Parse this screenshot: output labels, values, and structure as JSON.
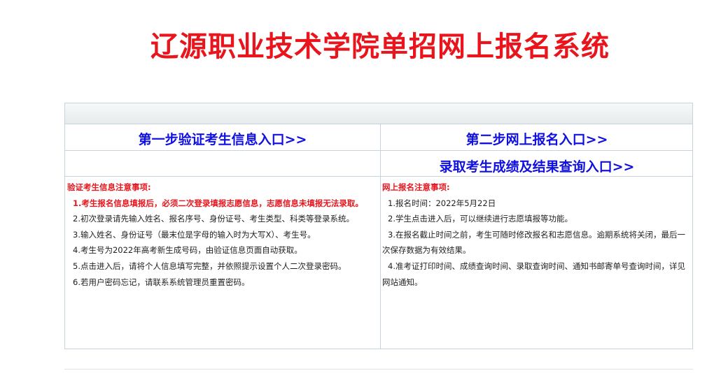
{
  "page_title": "辽源职业技术学院单招网上报名系统",
  "entries": {
    "step1": "第一步验证考生信息入口>>",
    "step2": "第二步网上报名入口>>",
    "results": "录取考生成绩及结果查询入口>>"
  },
  "verify_notes": {
    "heading": "验证考生信息注意事项:",
    "items": [
      "1.考生报名信息填报后，必须二次登录填报志愿信息，志愿信息未填报无法录取。",
      "2.初次登录请先输入姓名、报名序号、身份证号、考生类型、科类等登录系统。",
      "3.输入姓名、身份证号（最末位是字母的输入时为大写X）、考生号。",
      "4.考生号为2022年高考新生成号码，由验证信息页面自动获取。",
      "5.点击进入后，请将个人信息填写完整，并依照提示设置个人二次登录密码。",
      "6.若用户密码忘记，请联系系统管理员重置密码。"
    ]
  },
  "reg_notes": {
    "heading": "网上报名注意事项:",
    "items": [
      "1.报名时间：2022年5月22日",
      "2.学生点击进入后，可以继续进行志愿填报等功能。",
      "3.在报名截止时间之前，考生可随时修改报名和志愿信息。逾期系统将关闭，最后一次保存数据为有效结果。",
      "4.准考证打印时间、成绩查询时间、录取查询时间、通知书邮寄单号查询时间，详见网站通知。"
    ]
  }
}
